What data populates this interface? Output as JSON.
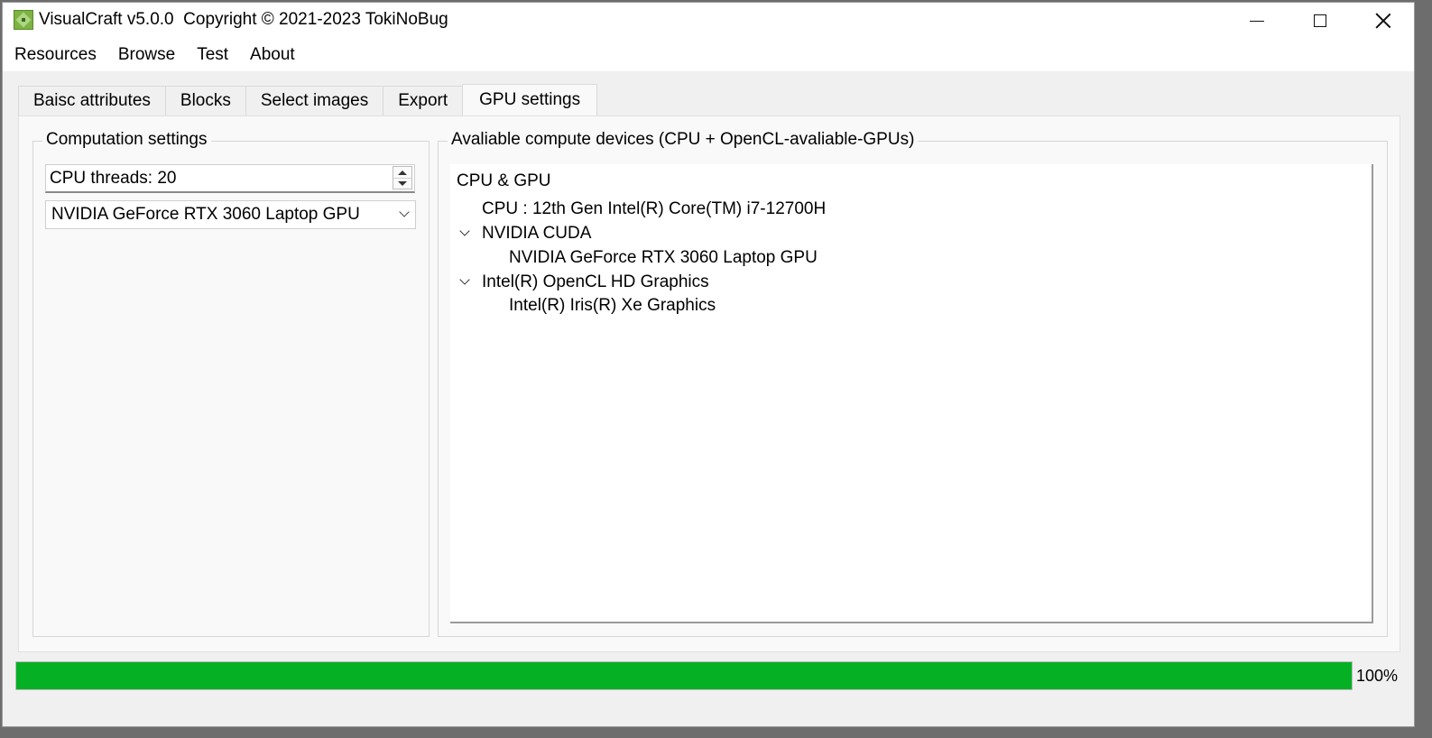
{
  "window": {
    "title": "VisualCraft v5.0.0  Copyright © 2021-2023 TokiNoBug",
    "controls": {
      "minimize": "minimize-icon",
      "maximize": "maximize-icon",
      "close": "close-icon"
    }
  },
  "menu": {
    "items": [
      "Resources",
      "Browse",
      "Test",
      "About"
    ]
  },
  "tabs": {
    "items": [
      "Baisc attributes",
      "Blocks",
      "Select images",
      "Export",
      "GPU settings"
    ],
    "active": "GPU settings"
  },
  "computation": {
    "title": "Computation settings",
    "threads_label": "CPU threads: 20",
    "device_selected": "NVIDIA GeForce RTX 3060 Laptop GPU"
  },
  "devices": {
    "title": "Avaliable compute devices (CPU + OpenCL-avaliable-GPUs)",
    "root": "CPU & GPU",
    "cpu": "CPU : 12th Gen Intel(R) Core(TM) i7-12700H",
    "platforms": [
      {
        "name": "NVIDIA CUDA",
        "expanded": true,
        "devices": [
          "NVIDIA GeForce RTX 3060 Laptop GPU"
        ]
      },
      {
        "name": "Intel(R) OpenCL HD Graphics",
        "expanded": true,
        "devices": [
          "Intel(R) Iris(R) Xe Graphics"
        ]
      }
    ]
  },
  "progress": {
    "value": 100,
    "label": "100%",
    "color": "#06b025"
  }
}
